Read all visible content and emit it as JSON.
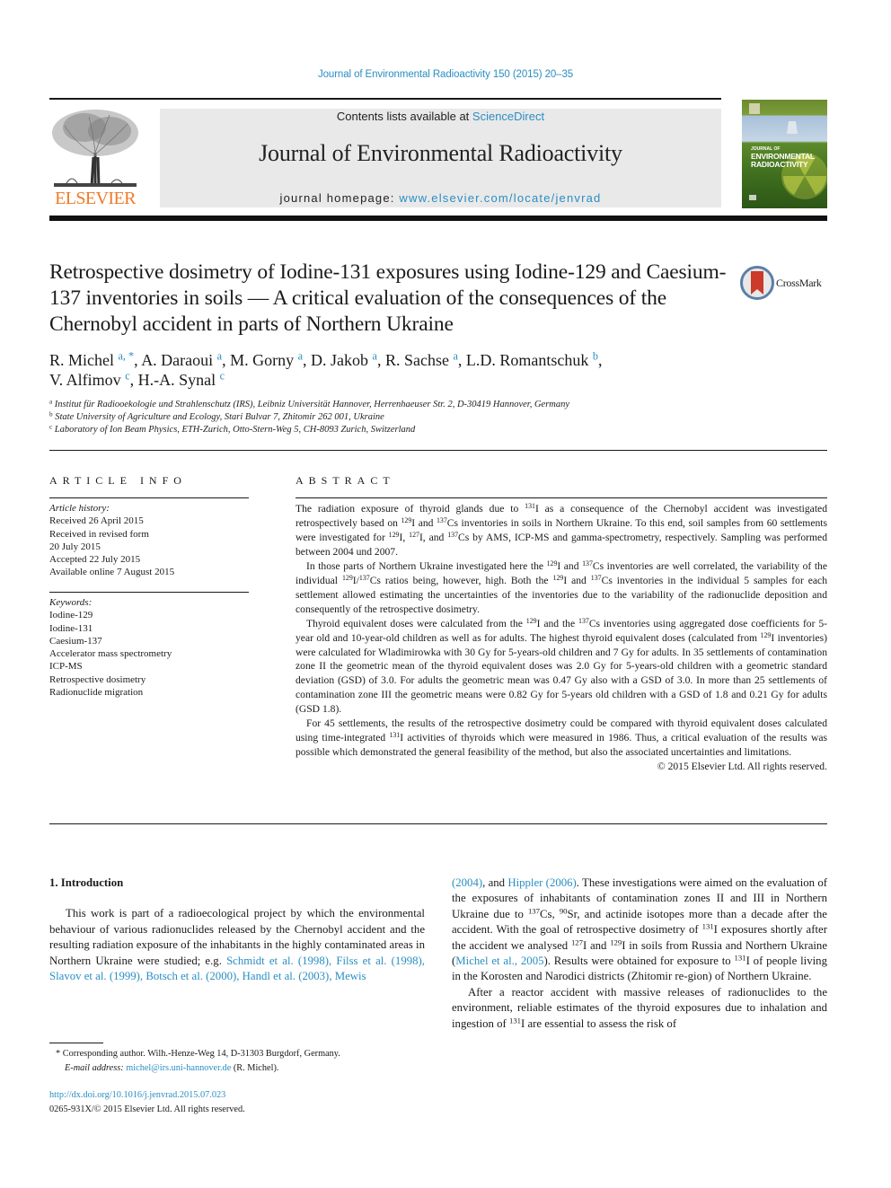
{
  "header": {
    "citation": "Journal of Environmental Radioactivity 150 (2015) 20–35",
    "contents_prefix": "Contents lists available at ",
    "contents_link": "ScienceDirect",
    "journal_title": "Journal of Environmental Radioactivity",
    "homepage_prefix": "journal homepage: ",
    "homepage_link": "www.elsevier.com/locate/jenvrad",
    "publisher_logo_text": "ELSEVIER",
    "cover": {
      "title_small": "JOURNAL OF",
      "title_line1": "ENVIRONMENTAL",
      "title_line2": "RADIOACTIVITY"
    },
    "crossmark_label": "CrossMark"
  },
  "article": {
    "title": "Retrospective dosimetry of Iodine-131 exposures using Iodine-129 and Caesium-137 inventories in soils — A critical evaluation of the consequences of the Chernobyl accident in parts of Northern Ukraine",
    "authors": [
      {
        "name": "R. Michel",
        "aff": "a, *"
      },
      {
        "name": "A. Daraoui",
        "aff": "a"
      },
      {
        "name": "M. Gorny",
        "aff": "a"
      },
      {
        "name": "D. Jakob",
        "aff": "a"
      },
      {
        "name": "R. Sachse",
        "aff": "a"
      },
      {
        "name": "L.D. Romantschuk",
        "aff": "b"
      },
      {
        "name": "V. Alfimov",
        "aff": "c"
      },
      {
        "name": "H.-A. Synal",
        "aff": "c"
      }
    ],
    "affiliations": [
      {
        "key": "a",
        "text": "Institut für Radiooekologie und Strahlenschutz (IRS), Leibniz Universität Hannover, Herrenhaeuser Str. 2, D-30419 Hannover, Germany"
      },
      {
        "key": "b",
        "text": "State University of Agriculture and Ecology, Stari Bulvar 7, Zhitomir 262 001, Ukraine"
      },
      {
        "key": "c",
        "text": "Laboratory of Ion Beam Physics, ETH-Zurich, Otto-Stern-Weg 5, CH-8093 Zurich, Switzerland"
      }
    ]
  },
  "article_info": {
    "heading": "ARTICLE INFO",
    "history_label": "Article history:",
    "history": [
      "Received 26 April 2015",
      "Received in revised form",
      "20 July 2015",
      "Accepted 22 July 2015",
      "Available online 7 August 2015"
    ],
    "keywords_label": "Keywords:",
    "keywords": [
      "Iodine-129",
      "Iodine-131",
      "Caesium-137",
      "Accelerator mass spectrometry",
      "ICP-MS",
      "Retrospective dosimetry",
      "Radionuclide migration"
    ]
  },
  "abstract": {
    "heading": "ABSTRACT",
    "p1": [
      "The radiation exposure of thyroid glands due to ",
      {
        "sup": "131"
      },
      "I as a consequence of the Chernobyl accident was investigated retrospectively based on ",
      {
        "sup": "129"
      },
      "I and ",
      {
        "sup": "137"
      },
      "Cs inventories in soils in Northern Ukraine. To this end, soil samples from 60 settlements were investigated for ",
      {
        "sup": "129"
      },
      "I, ",
      {
        "sup": "127"
      },
      "I, and ",
      {
        "sup": "137"
      },
      "Cs by AMS, ICP-MS and gamma-spectrometry, respectively. Sampling was performed between 2004 und 2007."
    ],
    "p2": [
      "In those parts of Northern Ukraine investigated here the ",
      {
        "sup": "129"
      },
      "I and ",
      {
        "sup": "137"
      },
      "Cs inventories are well correlated, the variability of the individual ",
      {
        "sup": "129"
      },
      "I/",
      {
        "sup": "137"
      },
      "Cs ratios being, however, high. Both the ",
      {
        "sup": "129"
      },
      "I and ",
      {
        "sup": "137"
      },
      "Cs inventories in the individual 5 samples for each settlement allowed estimating the uncertainties of the inventories due to the variability of the radionuclide deposition and consequently of the retrospective dosimetry."
    ],
    "p3": [
      "Thyroid equivalent doses were calculated from the ",
      {
        "sup": "129"
      },
      "I and the ",
      {
        "sup": "137"
      },
      "Cs inventories using aggregated dose coefficients for 5-year old and 10-year-old children as well as for adults. The highest thyroid equivalent doses (calculated from ",
      {
        "sup": "129"
      },
      "I inventories) were calculated for Wladimirowka with 30 Gy for 5-years-old children and 7 Gy for adults. In 35 settlements of contamination zone II the geometric mean of the thyroid equivalent doses was 2.0 Gy for 5-years-old children with a geometric standard deviation (GSD) of 3.0. For adults the geometric mean was 0.47 Gy also with a GSD of 3.0. In more than 25 settlements of contamination zone III the geometric means were 0.82 Gy for 5-years old children with a GSD of 1.8 and 0.21 Gy for adults (GSD 1.8)."
    ],
    "p4": [
      "For 45 settlements, the results of the retrospective dosimetry could be compared with thyroid equivalent doses calculated using time-integrated ",
      {
        "sup": "131"
      },
      "I activities of thyroids which were measured in 1986. Thus, a critical evaluation of the results was possible which demonstrated the general feasibility of the method, but also the associated uncertainties and limitations."
    ],
    "copyright": "© 2015 Elsevier Ltd. All rights reserved."
  },
  "introduction": {
    "heading": "1.  Introduction",
    "left_p1": [
      "This work is part of a radioecological project by which the environmental behaviour of various radionuclides released by the Chernobyl accident and the resulting radiation exposure of the inhabitants in the highly contaminated areas in Northern Ukraine were studied; e.g. ",
      {
        "link": "Schmidt et al. (1998), Filss et al. (1998), Slavov et al. (1999), Botsch et al. (2000), Handl et al. (2003), Mewis"
      }
    ],
    "right_p1": [
      {
        "link": "(2004)"
      },
      ", and ",
      {
        "link": "Hippler (2006)"
      },
      ". These investigations were aimed on the evaluation of the exposures of inhabitants of contamination zones II and III in Northern Ukraine due to ",
      {
        "sup": "137"
      },
      "Cs, ",
      {
        "sup": "90"
      },
      "Sr, and actinide isotopes more than a decade after the accident. With the goal of retrospective dosimetry of ",
      {
        "sup": "131"
      },
      "I exposures shortly after the accident we analysed ",
      {
        "sup": "127"
      },
      "I and ",
      {
        "sup": "129"
      },
      "I in soils from Russia and Northern Ukraine (",
      {
        "link": "Michel et al., 2005"
      },
      "). Results were obtained for exposure to ",
      {
        "sup": "131"
      },
      "I of people living in the Korosten and Narodici districts (Zhitomir re-gion) of Northern Ukraine."
    ],
    "right_p2": [
      "After a reactor accident with massive releases of radionuclides to the environment, reliable estimates of the thyroid exposures due to inhalation and ingestion of ",
      {
        "sup": "131"
      },
      "I are essential to assess the risk of"
    ]
  },
  "footnotes": {
    "corresponding": "*  Corresponding author. Wilh.-Henze-Weg 14, D-31303 Burgdorf, Germany.",
    "email_label": "E-mail address: ",
    "email": "michel@irs.uni-hannover.de",
    "email_suffix": " (R. Michel).",
    "doi": "http://dx.doi.org/10.1016/j.jenvrad.2015.07.023",
    "issn": "0265-931X/© 2015 Elsevier Ltd. All rights reserved."
  },
  "colors": {
    "link": "#2a8ec2",
    "elsevier_orange": "#f07a26",
    "masthead_bg": "#e9e9e9"
  }
}
